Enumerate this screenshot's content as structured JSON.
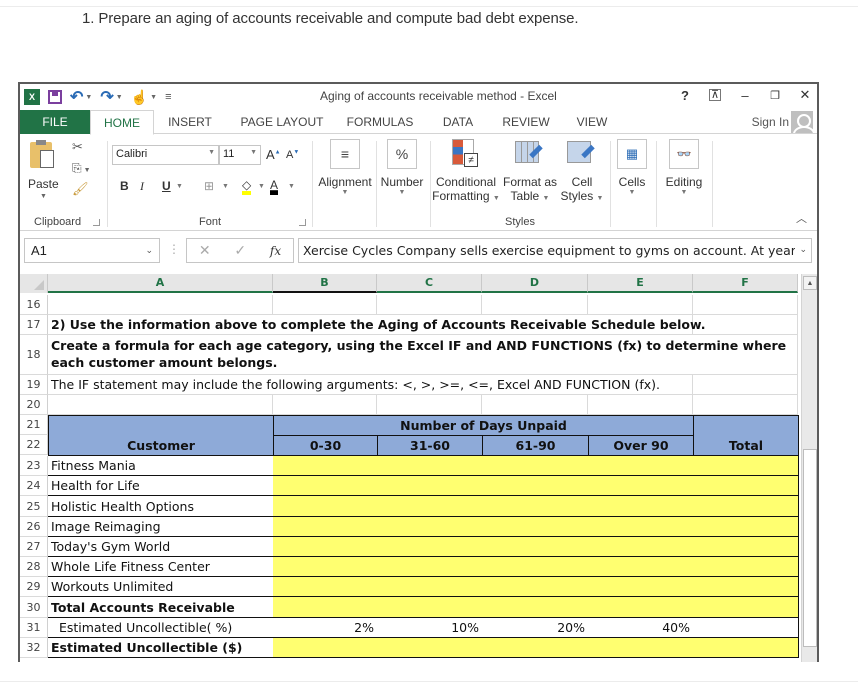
{
  "question": "1.  Prepare an aging of accounts receivable and compute bad debt expense.",
  "window": {
    "title": "Aging of accounts receivable method - Excel",
    "controls": {
      "help": "?",
      "restore_ribbon": "⊼",
      "minimize": "–",
      "restore": "🗗",
      "close": "✕"
    }
  },
  "qat": {
    "excel_logo": "X",
    "undo": "↶",
    "redo": "↷",
    "touch": "☝",
    "customize": "≡"
  },
  "tabs": [
    "FILE",
    "HOME",
    "INSERT",
    "PAGE LAYOUT",
    "FORMULAS",
    "DATA",
    "REVIEW",
    "VIEW"
  ],
  "sign_in": "Sign In",
  "ribbon": {
    "clipboard": {
      "paste": "Paste",
      "label": "Clipboard"
    },
    "font": {
      "name": "Calibri",
      "size": "11",
      "grow": "A",
      "shrink": "A",
      "bold": "B",
      "italic": "I",
      "underline": "U",
      "label": "Font"
    },
    "alignment": {
      "label": "Alignment",
      "icon": "≡"
    },
    "number": {
      "label": "Number",
      "icon": "%"
    },
    "styles": {
      "conditional_1": "Conditional",
      "conditional_2": "Formatting",
      "format_table_1": "Format as",
      "format_table_2": "Table",
      "cell_styles_1": "Cell",
      "cell_styles_2": "Styles",
      "label": "Styles"
    },
    "cells": {
      "label": "Cells"
    },
    "editing": {
      "label": "Editing",
      "icon": "🔍"
    }
  },
  "formula_bar": {
    "name_box": "A1",
    "cancel": "✕",
    "enter": "✓",
    "fx": "fx",
    "content": "Xercise Cycles Company sells exercise equipment to gyms on account.  At year"
  },
  "columns": [
    "A",
    "B",
    "C",
    "D",
    "E",
    "F"
  ],
  "rows": {
    "r16": {
      "num": "16"
    },
    "r17": {
      "num": "17",
      "text": "2) Use the information above to complete the Aging of Accounts Receivable Schedule below."
    },
    "r18": {
      "num": "18",
      "text": "Create a formula for each age category, using the Excel IF and AND FUNCTIONS (fx) to determine where each customer amount belongs."
    },
    "r19": {
      "num": "19",
      "text": "The IF statement may include the following arguments:  <, >, >=, <=, Excel AND FUNCTION (fx)."
    },
    "r20": {
      "num": "20"
    },
    "r21": {
      "num": "21",
      "group_header": "Number of Days Unpaid"
    },
    "r22": {
      "num": "22",
      "customer": "Customer",
      "b": "0-30",
      "c": "31-60",
      "d": "61-90",
      "e": "Over 90",
      "total": "Total"
    }
  },
  "customers": [
    {
      "num": "23",
      "name": "Fitness Mania"
    },
    {
      "num": "24",
      "name": "Health for Life"
    },
    {
      "num": "25",
      "name": "Holistic Health Options"
    },
    {
      "num": "26",
      "name": "Image Reimaging"
    },
    {
      "num": "27",
      "name": "Today's Gym World"
    },
    {
      "num": "28",
      "name": "Whole Life Fitness Center"
    },
    {
      "num": "29",
      "name": "Workouts Unlimited"
    }
  ],
  "total_row": {
    "num": "30",
    "label": "Total Accounts Receivable"
  },
  "pct_row": {
    "num": "31",
    "label": "  Estimated Uncollectible( %)",
    "b": "2%",
    "c": "10%",
    "d": "20%",
    "e": "40%"
  },
  "est_row": {
    "num": "32",
    "label": "Estimated Uncollectible ($)"
  },
  "colors": {
    "excel_green": "#217346",
    "header_blue": "#8eaad8",
    "input_yellow": "#ffff70"
  }
}
